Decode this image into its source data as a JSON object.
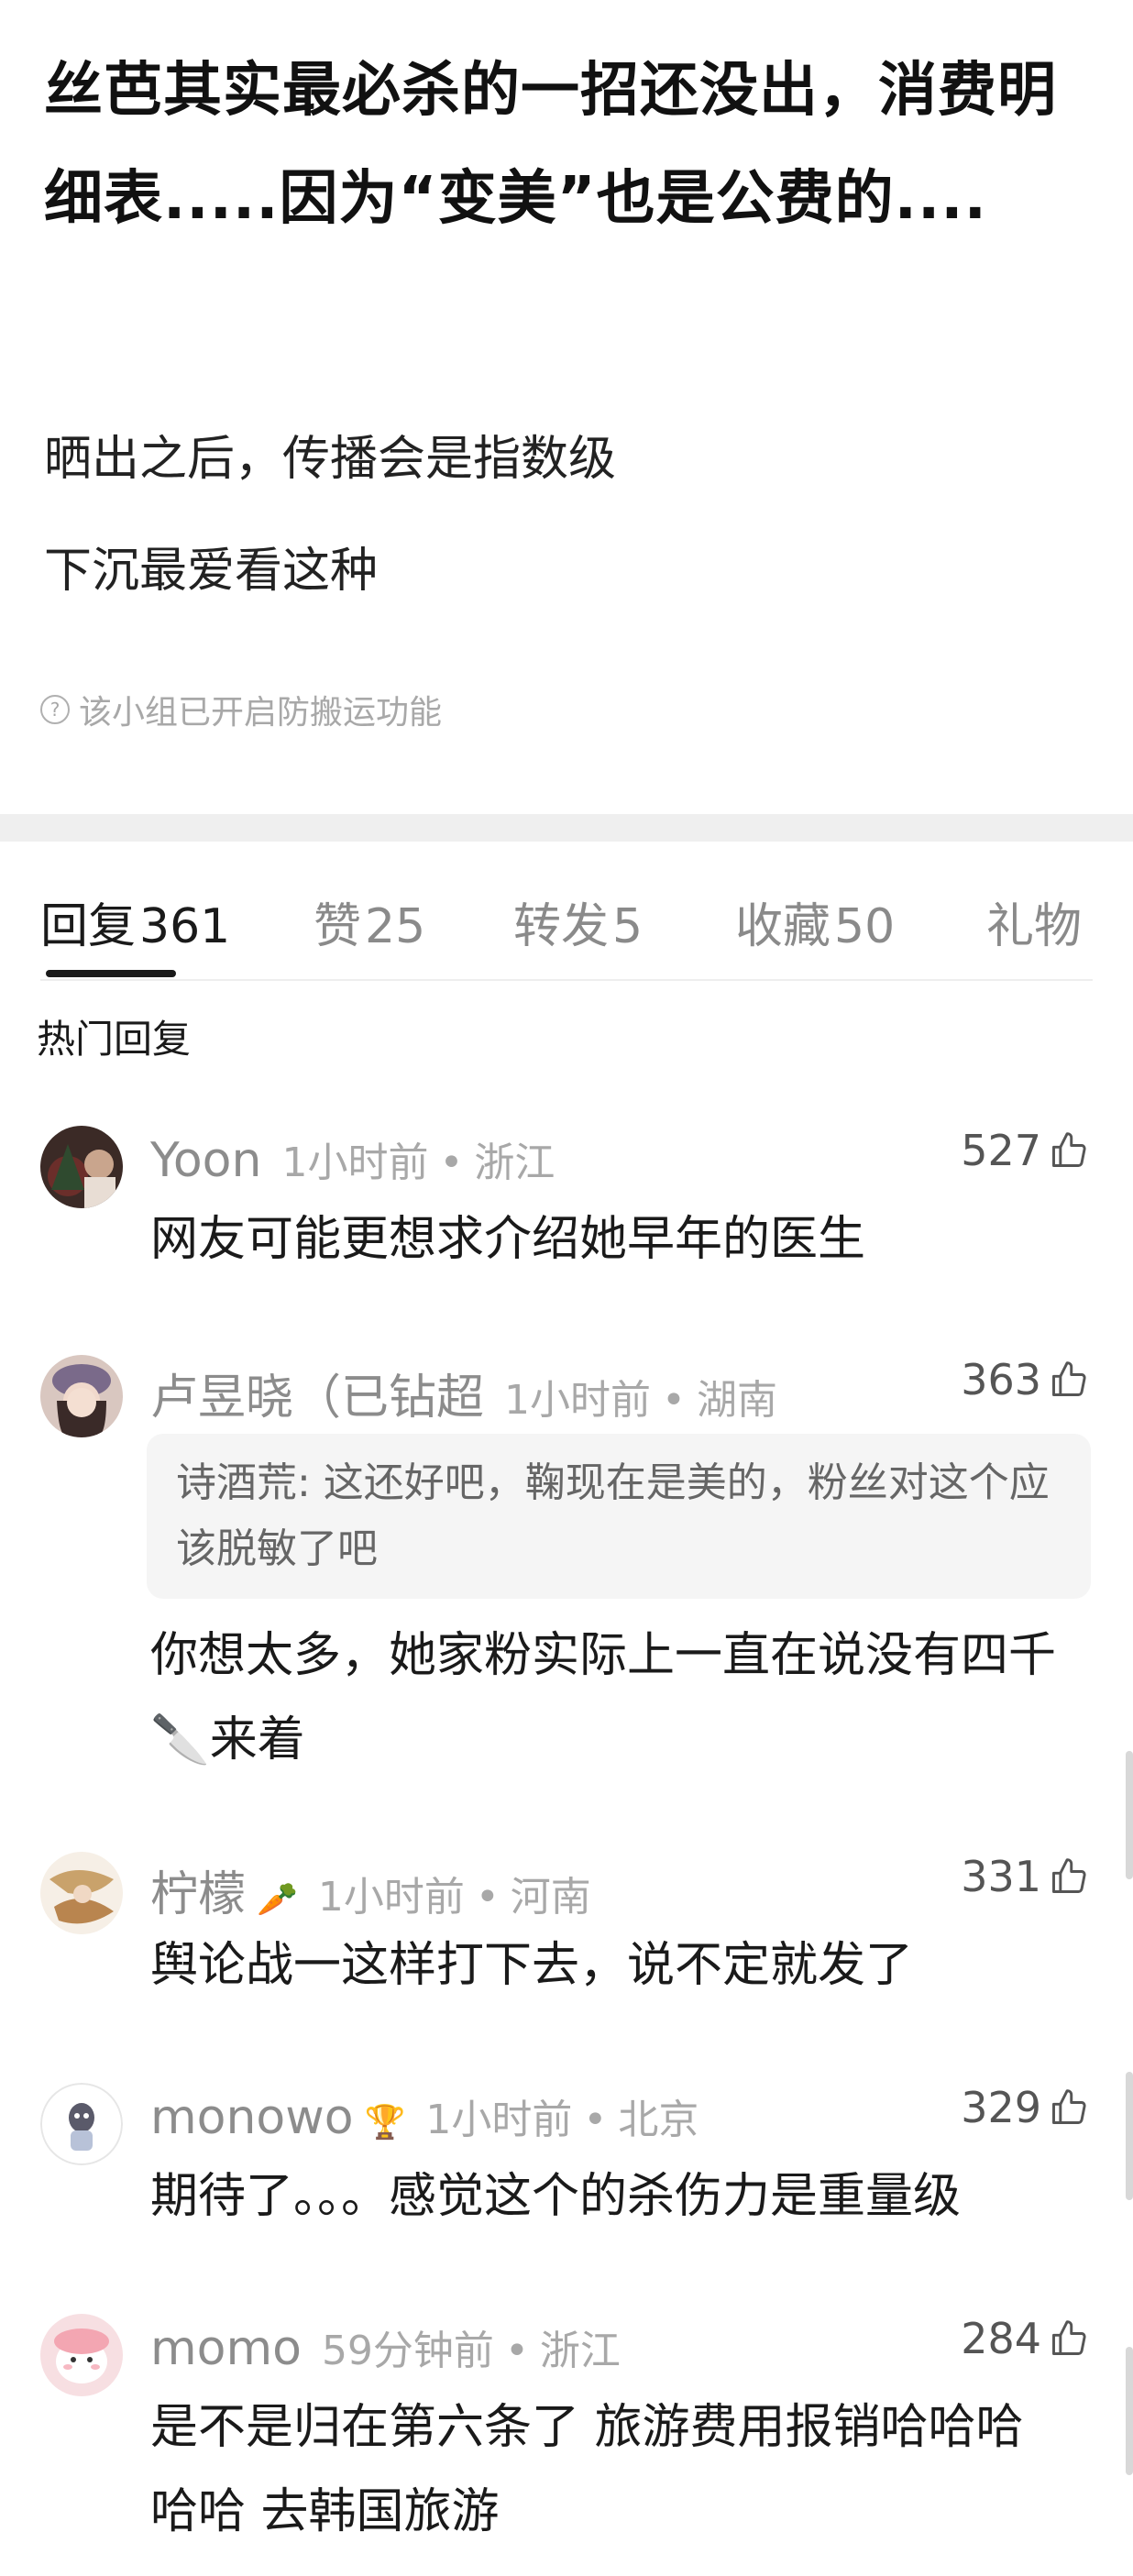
{
  "post": {
    "title": "丝芭其实最必杀的一招还没出，消费明细表.....因为“变美”也是公费的....",
    "line1": "晒出之后，传播会是指数级",
    "line2": "下沉最爱看这种",
    "notice": "该小组已开启防搬运功能"
  },
  "tabs": [
    {
      "label": "回复",
      "count": "361"
    },
    {
      "label": "赞",
      "count": "25"
    },
    {
      "label": "转发",
      "count": "5"
    },
    {
      "label": "收藏",
      "count": "50"
    },
    {
      "label": "礼物",
      "count": ""
    }
  ],
  "section_label": "热门回复",
  "comments": [
    {
      "name": "Yoon",
      "badge": "",
      "time": "1小时前",
      "region": "浙江",
      "likes": "527",
      "quote": "",
      "body": "网友可能更想求介绍她早年的医生"
    },
    {
      "name": "卢昱晓（已钻超",
      "badge": "",
      "time": "1小时前",
      "region": "湖南",
      "likes": "363",
      "quote": "诗酒荒: 这还好吧，鞠现在是美的，粉丝对这个应该脱敏了吧",
      "body": "你想太多，她家粉实际上一直在说没有四千🔪来着"
    },
    {
      "name": "柠檬",
      "badge": "🥕",
      "time": "1小时前",
      "region": "河南",
      "likes": "331",
      "quote": "",
      "body": "舆论战一这样打下去，说不定就发了"
    },
    {
      "name": "monowo",
      "badge": "🏆",
      "time": "1小时前",
      "region": "北京",
      "likes": "329",
      "quote": "",
      "body": "期待了。。。感觉这个的杀伤力是重量级"
    },
    {
      "name": "momo",
      "badge": "",
      "time": "59分钟前",
      "region": "浙江",
      "likes": "284",
      "quote": "",
      "body": "是不是归在第六条了 旅游费用报销哈哈哈哈哈 去韩国旅游"
    }
  ],
  "colors": {
    "accent": "#1a1a1a",
    "muted": "#8c8c8c",
    "quote_bg": "#f5f5f5"
  }
}
